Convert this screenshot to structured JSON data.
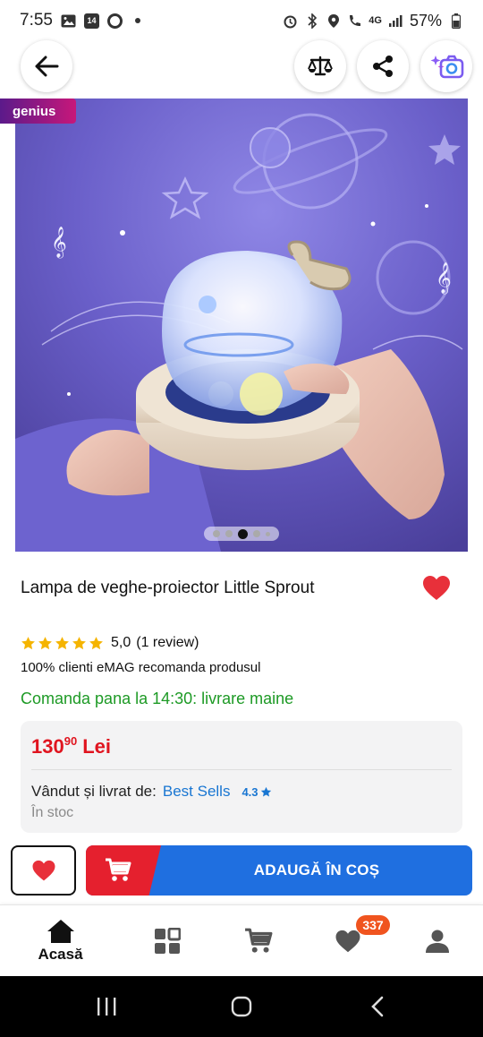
{
  "status_bar": {
    "time": "7:55",
    "notif_count": "14",
    "network": "4G",
    "battery": "57%"
  },
  "top_bar": {
    "icons": [
      "back-arrow-icon",
      "compare-icon",
      "share-icon",
      "camera-search-icon"
    ]
  },
  "badge": {
    "label": "genius"
  },
  "gallery": {
    "image_count": 5,
    "active_index": 2
  },
  "product": {
    "title": "Lampa de veghe-proiector Little Sprout",
    "rating_value": "5,0",
    "rating_count": "(1 review)",
    "stars": 5,
    "recommend": "100% clienti eMAG recomanda produsul",
    "delivery": "Comanda pana la 14:30: livrare maine"
  },
  "price": {
    "main": "130",
    "cents": "90",
    "currency": "Lei",
    "seller_label": "Vândut și livrat de:",
    "seller_name": "Best Sells",
    "seller_rating": "4.3",
    "stock": "În stoc"
  },
  "actions": {
    "add_to_cart": "ADAUGĂ ÎN COȘ"
  },
  "bottom_nav": {
    "home_label": "Acasă",
    "favorites_count": "337"
  },
  "colors": {
    "price": "#e0141f",
    "delivery": "#1d9a25",
    "cart_blue": "#1f6fe0",
    "cart_red": "#e5202e",
    "heart": "#e8303a",
    "badge": "#f0541f",
    "star": "#f5b400"
  }
}
